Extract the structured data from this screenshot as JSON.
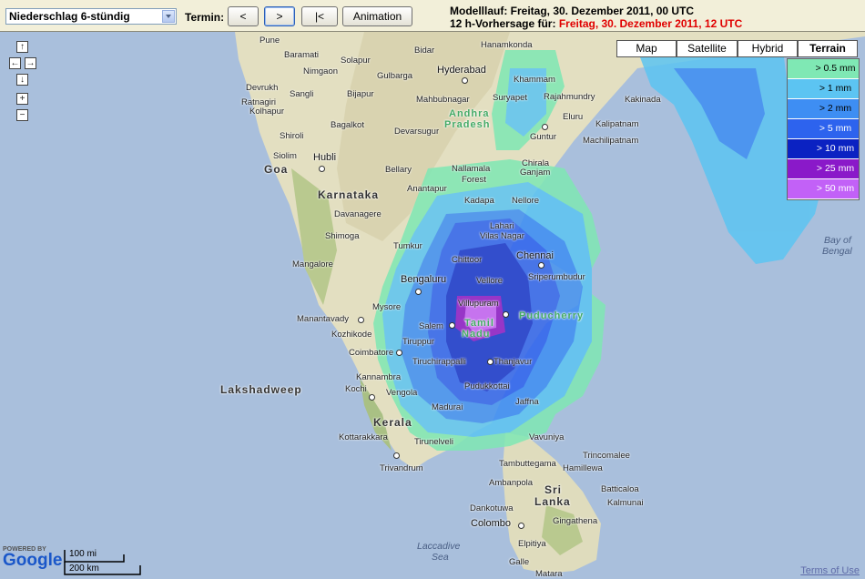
{
  "toolbar": {
    "product_select": "Niederschlag 6-stündig",
    "termin_label": "Termin:",
    "prev_label": "<",
    "next_label": ">",
    "first_label": "|<",
    "animation_label": "Animation",
    "model_run": "Modelllauf: Freitag, 30. Dezember 2011, 00 UTC",
    "forecast_prefix": "12 h-Vorhersage für: ",
    "forecast_time": "Freitag, 30. Dezember 2011, 12 UTC"
  },
  "map_types": [
    "Map",
    "Satellite",
    "Hybrid",
    "Terrain"
  ],
  "active_map_type": "Terrain",
  "legend": [
    {
      "label": "> 0.5 mm",
      "color": "#7fe8b4"
    },
    {
      "label": "> 1 mm",
      "color": "#5cc4f2"
    },
    {
      "label": "> 2 mm",
      "color": "#3e8ef3"
    },
    {
      "label": "> 5 mm",
      "color": "#2d63ee"
    },
    {
      "label": "> 10 mm",
      "color": "#0b22c2"
    },
    {
      "label": "> 25 mm",
      "color": "#8a19c9"
    },
    {
      "label": "> 50 mm",
      "color": "#c261f7"
    }
  ],
  "places": {
    "pune": "Pune",
    "baramati": "Baramati",
    "solapur": "Solapur",
    "bidar": "Bidar",
    "hanamkonda": "Hanamkonda",
    "nimgaon": "Nimgaon",
    "gulbarga": "Gulbarga",
    "hyderabad": "Hyderabad",
    "khammam": "Khammam",
    "devrukh": "Devrukh",
    "sangli": "Sangli",
    "bijapur": "Bijapur",
    "suryapet": "Suryapet",
    "rajahmundry": "Rajahmundry",
    "kakinada": "Kakinada",
    "ratnagiri": "Ratnagiri",
    "kolhapur": "Kolhapur",
    "mahbubnagar": "Mahbubnagar",
    "andhra": "Andhra",
    "pradesh": "Pradesh",
    "eluru": "Eluru",
    "kalipatnam": "Kalipatnam",
    "bagalkot": "Bagalkot",
    "devarsugur": "Devarsugur",
    "guntur": "Guntur",
    "machilipatnam": "Machilipatnam",
    "shiroli": "Shiroli",
    "siolim": "Siolim",
    "hubli": "Hubli",
    "goa": "Goa",
    "bellary": "Bellary",
    "nallamala": "Nallamala",
    "forest": "Forest",
    "chirala": "Chirala",
    "ganjam": "Ganjam",
    "karnataka": "Karnataka",
    "anantapur": "Anantapur",
    "davanagere": "Davanagere",
    "kadapa": "Kadapa",
    "nellore": "Nellore",
    "shimoga": "Shimoga",
    "lahari": "Lahari",
    "vilas_nagar": "Vilas Nagar",
    "tumkur": "Tumkur",
    "mangalore": "Mangalore",
    "chittoor": "Chittoor",
    "chennai": "Chennai",
    "bengaluru": "Bengaluru",
    "vellore": "Vellore",
    "sriperumbudur": "Sriperumbudur",
    "mysore": "Mysore",
    "villupuram": "Villupuram",
    "tamil": "Tamil",
    "nadu": "Nadu",
    "puducherry": "Puducherry",
    "manantavady": "Manantavady",
    "salem": "Salem",
    "kozhikode": "Kozhikode",
    "tiruppur": "Tiruppur",
    "coimbatore": "Coimbatore",
    "tiruchirappalli": "Tiruchirappalli",
    "thanjavur": "Thanjavur",
    "lakshadweep": "Lakshadweep",
    "kannambra": "Kannambra",
    "kochi": "Kochi",
    "vengola": "Vengola",
    "pudukkottai": "Pudukkottai",
    "jaffna": "Jaffna",
    "madurai": "Madurai",
    "kerala": "Kerala",
    "kottarakkara": "Kottarakkara",
    "tirunelveli": "Tirunelveli",
    "vavuniya": "Vavuniya",
    "trincomalee": "Trincomalee",
    "trivandrum": "Trivandrum",
    "tambuttegama": "Tambuttegama",
    "hamillewa": "Hamillewa",
    "ambanpola": "Ambanpola",
    "sri": "Sri",
    "lanka": "Lanka",
    "batticaloa": "Batticaloa",
    "kalmunai": "Kalmunai",
    "dankotuwa": "Dankotuwa",
    "gingathena": "Gingathena",
    "colombo": "Colombo",
    "laccadive": "Laccadive",
    "sea": "Sea",
    "elpitiya": "Elpitiya",
    "galle": "Galle",
    "matara": "Matara",
    "bay_of": "Bay of",
    "bengal": "Bengal"
  },
  "footer": {
    "powered_by": "POWERED BY",
    "google": "Google",
    "scale_mi": "100 mi",
    "scale_km": "200 km",
    "terms": "Terms of Use"
  }
}
